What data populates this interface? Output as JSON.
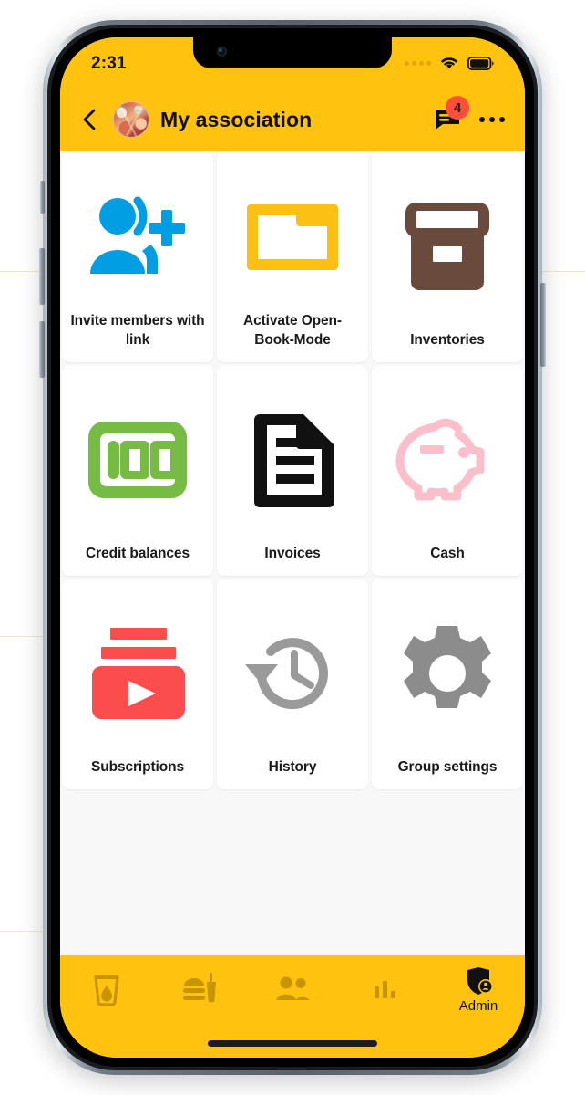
{
  "status_bar": {
    "time": "2:31",
    "signal_icon": "signal-dots-icon",
    "wifi_icon": "wifi-icon",
    "battery_icon": "battery-full-icon"
  },
  "header": {
    "back_icon": "back-chevron-icon",
    "avatar_icon": "group-avatar-photo",
    "title": "My association",
    "chat_icon": "chat-bubble-icon",
    "chat_badge_count": "4",
    "overflow_icon": "more-horizontal-icon"
  },
  "colors": {
    "brand_yellow": "#FFC20E",
    "badge_red": "#FF4E3A",
    "invite_blue": "#029EE4",
    "folder_yellow": "#FCBF14",
    "inventory_brown": "#6B4A3E",
    "credit_green": "#76BB43",
    "invoice_black": "#111111",
    "cash_pink": "#FBBFCB",
    "subscription_red": "#FB4D4D",
    "history_gray": "#9A9A9A",
    "settings_gray": "#8C8C8C",
    "screen_bg": "#F8F8F8",
    "tile_bg": "#FFFFFF"
  },
  "grid": {
    "tiles": [
      {
        "label": "Invite members with link",
        "icon": "person-add-icon",
        "color": "#029EE4"
      },
      {
        "label": "Activate Open-Book-Mode",
        "icon": "folder-icon",
        "color": "#FCBF14"
      },
      {
        "label": "Inventories",
        "icon": "archive-box-icon",
        "color": "#6B4A3E"
      },
      {
        "label": "Credit balances",
        "icon": "hundred-note-icon",
        "color": "#76BB43"
      },
      {
        "label": "Invoices",
        "icon": "document-icon",
        "color": "#111111"
      },
      {
        "label": "Cash",
        "icon": "piggy-bank-icon",
        "color": "#FBBFCB"
      },
      {
        "label": "Subscriptions",
        "icon": "subscriptions-icon",
        "color": "#FB4D4D"
      },
      {
        "label": "History",
        "icon": "history-clock-icon",
        "color": "#9A9A9A"
      },
      {
        "label": "Group settings",
        "icon": "gear-icon",
        "color": "#8C8C8C"
      }
    ]
  },
  "bottom_nav": {
    "items": [
      {
        "icon": "drink-glass-icon",
        "label": "",
        "active": false
      },
      {
        "icon": "fastfood-icon",
        "label": "",
        "active": false
      },
      {
        "icon": "people-icon",
        "label": "",
        "active": false
      },
      {
        "icon": "bar-chart-icon",
        "label": "",
        "active": false
      },
      {
        "icon": "admin-shield-icon",
        "label": "Admin",
        "active": true
      }
    ]
  }
}
